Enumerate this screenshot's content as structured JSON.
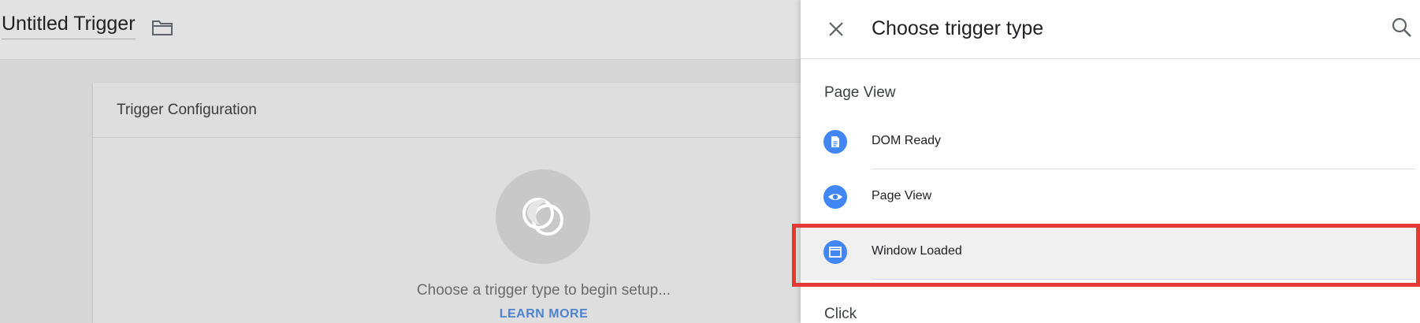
{
  "header": {
    "trigger_name": "Untitled Trigger",
    "folder_icon": "folder-icon"
  },
  "card": {
    "title": "Trigger Configuration",
    "placeholder_icon": "trigger-placeholder-icon",
    "setup_text": "Choose a trigger type to begin setup...",
    "learn_more": "LEARN MORE"
  },
  "panel": {
    "title": "Choose trigger type",
    "close_icon": "close-icon",
    "search_icon": "search-icon",
    "sections": [
      {
        "label": "Page View",
        "items": [
          {
            "label": "DOM Ready",
            "icon": "document-icon"
          },
          {
            "label": "Page View",
            "icon": "eye-icon"
          },
          {
            "label": "Window Loaded",
            "icon": "window-icon",
            "highlighted": true
          }
        ]
      },
      {
        "label": "Click",
        "items": []
      }
    ]
  },
  "colors": {
    "accent": "#4285f4",
    "highlight_border": "#e53935",
    "learn_more": "#4f83cc"
  }
}
